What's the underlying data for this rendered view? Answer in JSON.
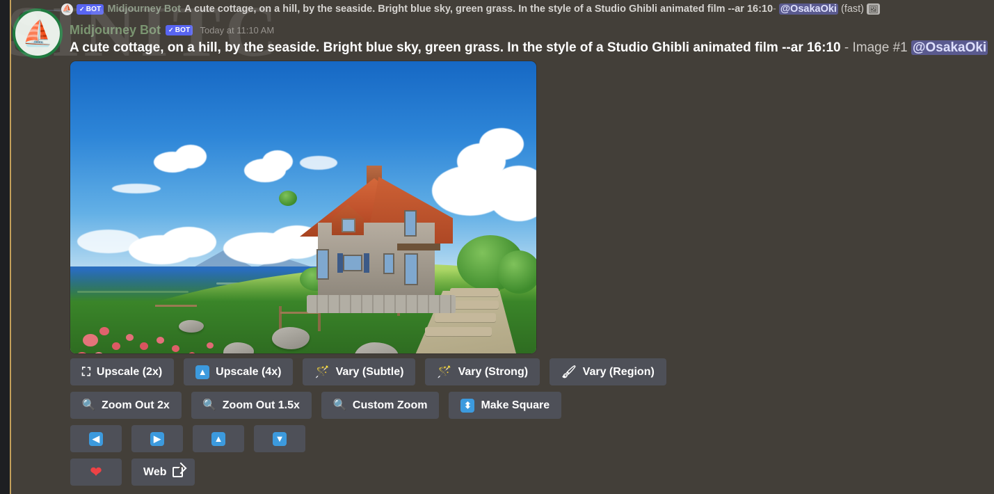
{
  "reply": {
    "bot_badge": "BOT",
    "check": "✓",
    "author": "Midjourney Bot",
    "prompt": "A cute cottage, on a hill, by the seaside. Bright blue sky, green grass. In the style of a Studio Ghibli animated film --ar 16:10",
    "separator": "-",
    "mention": "@OsakaOki",
    "mode": "(fast)",
    "attachment_icon": "image-attachment-icon"
  },
  "message": {
    "author": "Midjourney Bot",
    "bot_badge": "BOT",
    "check": "✓",
    "timestamp": "Today at 11:10 AM",
    "prompt": "A cute cottage, on a hill, by the seaside. Bright blue sky, green grass. In the style of a Studio Ghibli animated film --ar 16:10",
    "separator": "-",
    "image_label": "Image #1",
    "mention": "@OsakaOki"
  },
  "watermark": "SINITC",
  "image": {
    "alt": "Ghibli style cottage on a green hill by the seaside with blue sky and clouds"
  },
  "buttons": {
    "row1": [
      {
        "icon": "expand-arrows-icon",
        "glyph": "⛶",
        "label": "Upscale (2x)"
      },
      {
        "icon": "up-arrow-blue-icon",
        "glyph": "⬆",
        "label": "Upscale (4x)"
      },
      {
        "icon": "sparkles-wand-icon",
        "glyph": "🪄",
        "label": "Vary (Subtle)"
      },
      {
        "icon": "sparkles-wand-icon",
        "glyph": "🪄",
        "label": "Vary (Strong)"
      },
      {
        "icon": "paintbrush-icon",
        "glyph": "🖌",
        "label": "Vary (Region)"
      }
    ],
    "row2": [
      {
        "icon": "magnifying-glass-icon",
        "glyph": "🔍",
        "label": "Zoom Out 2x"
      },
      {
        "icon": "magnifying-glass-icon",
        "glyph": "🔍",
        "label": "Zoom Out 1.5x"
      },
      {
        "icon": "magnifying-glass-icon",
        "glyph": "🔍",
        "label": "Custom Zoom"
      },
      {
        "icon": "up-down-arrow-icon",
        "glyph": "⬍",
        "label": "Make Square"
      }
    ],
    "row3": [
      {
        "icon": "arrow-left-icon",
        "glyph": "⬅",
        "label": ""
      },
      {
        "icon": "arrow-right-icon",
        "glyph": "➡",
        "label": ""
      },
      {
        "icon": "arrow-up-icon",
        "glyph": "⬆",
        "label": ""
      },
      {
        "icon": "arrow-down-icon",
        "glyph": "⬇",
        "label": ""
      }
    ],
    "row4": [
      {
        "icon": "heart-icon",
        "glyph": "❤",
        "label": ""
      },
      {
        "icon": "external-link-icon",
        "glyph": "",
        "label": "Web"
      }
    ]
  },
  "colors": {
    "mention_highlight_bg": "#433f39",
    "mention_bar": "#c39f5a",
    "button_bg": "#4e5058",
    "bot_badge": "#5865f2",
    "author_green": "#7a9470",
    "mention_pill": "#5a5a8f",
    "heart_red": "#ed4245",
    "blue_emoji": "#3c9ade"
  }
}
